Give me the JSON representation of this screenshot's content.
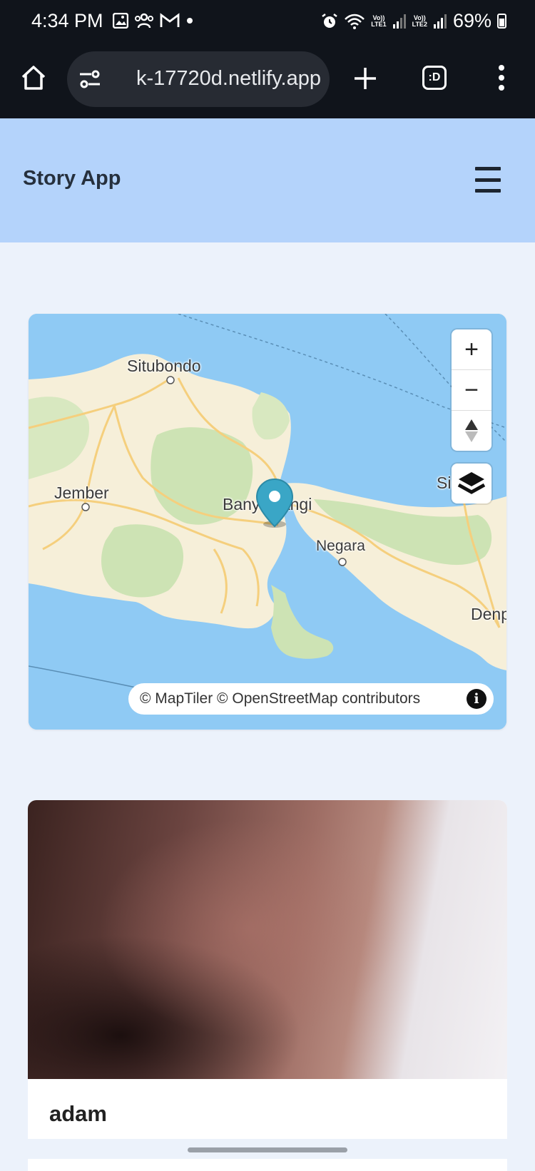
{
  "status_bar": {
    "time": "4:34 PM",
    "net1": "Vo))\nLTE1",
    "net2": "Vo))\nLTE2",
    "battery": "69%"
  },
  "browser": {
    "url": "k-17720d.netlify.app",
    "tab_badge": ":D"
  },
  "app": {
    "title": "Story App"
  },
  "map": {
    "labels": {
      "situbondo": "Situbondo",
      "jember": "Jember",
      "banyuwangi": "Banyuwangi",
      "negara": "Negara",
      "singaraja": "Si    ja",
      "denpasar": "Denp"
    },
    "zoom_in": "+",
    "zoom_out": "−",
    "attribution": "© MapTiler © OpenStreetMap contributors",
    "info": "i",
    "colors": {
      "water": "#8fcaf4",
      "land": "#f6efd9",
      "forest": "#cde3b4",
      "marker": "#3aa6c6"
    }
  },
  "stories": [
    {
      "name": "adam"
    }
  ]
}
